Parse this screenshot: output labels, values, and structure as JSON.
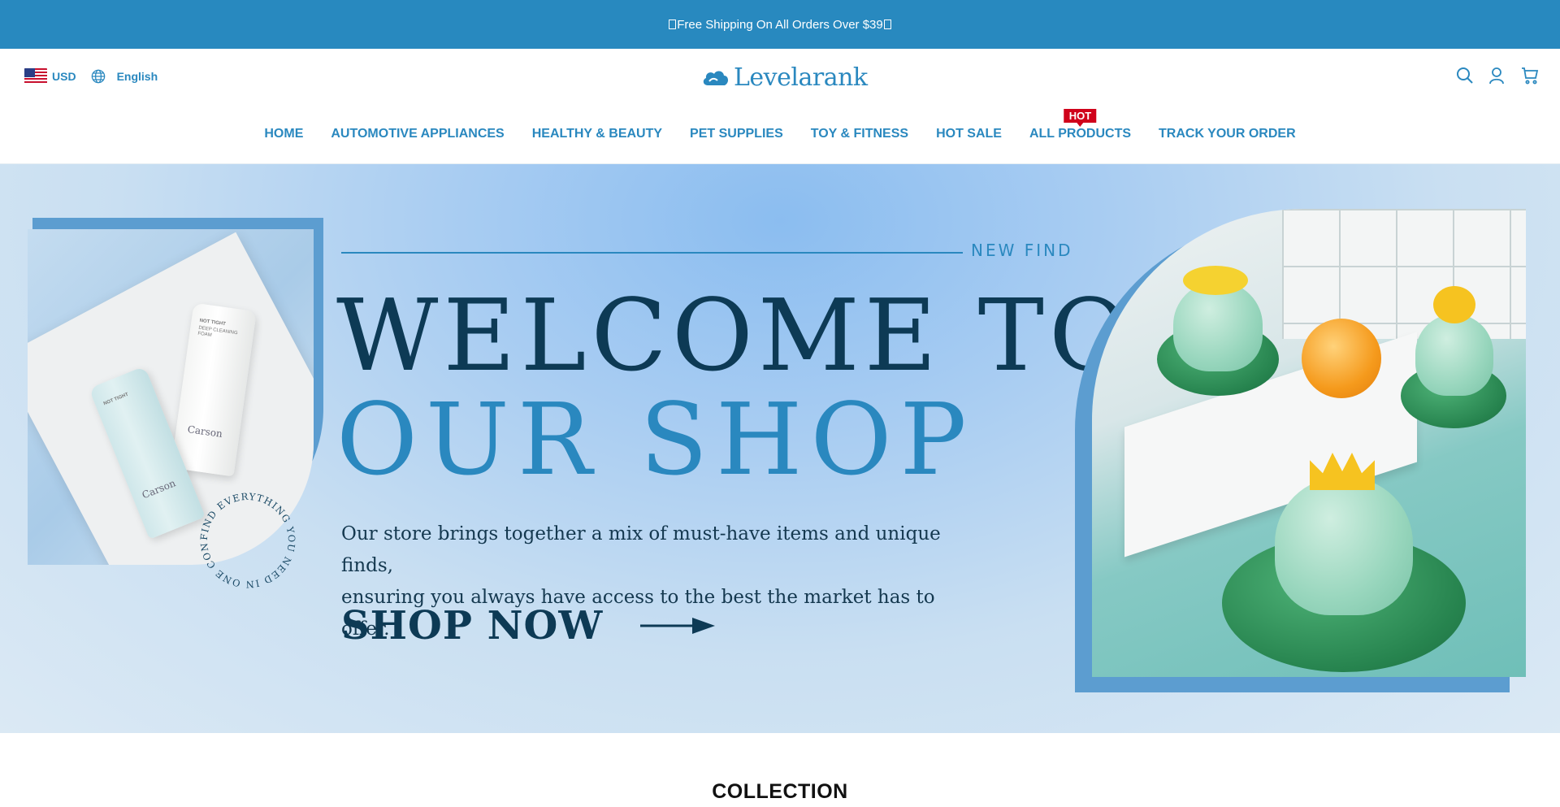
{
  "announcement": {
    "text": "Free Shipping On All Orders Over $39"
  },
  "header": {
    "currency": "USD",
    "language": "English",
    "logo_text": "Levelarank",
    "icons": [
      "search-icon",
      "account-icon",
      "cart-icon"
    ]
  },
  "nav": {
    "items": [
      {
        "label": "HOME"
      },
      {
        "label": "AUTOMOTIVE APPLIANCES"
      },
      {
        "label": "HEALTHY & BEAUTY"
      },
      {
        "label": "PET SUPPLIES"
      },
      {
        "label": "TOY & FITNESS"
      },
      {
        "label": "HOT SALE"
      },
      {
        "label": "ALL PRODUCTS",
        "badge": "HOT"
      },
      {
        "label": "TRACK YOUR ORDER"
      }
    ]
  },
  "hero": {
    "tagline": "NEW FIND",
    "title_line1": "WELCOME TO",
    "title_line2": "OUR SHOP",
    "description_line1": "Our store brings together a mix of must-have items and unique finds,",
    "description_line2": "ensuring you always have access to the best the market has to offer.",
    "cta": "SHOP NOW",
    "circle_text": "FIND EVERYTHING YOU NEED IN ONE CONVENIENT",
    "product_brand": "Carson",
    "product_name": "NOT TIGHT",
    "product_detail": "DEEP CLEANING FOAM"
  },
  "section": {
    "title": "COLLECTION"
  },
  "colors": {
    "brand_blue": "#2889bf",
    "dark_navy": "#0d3a55",
    "hot_badge": "#d0021b"
  }
}
